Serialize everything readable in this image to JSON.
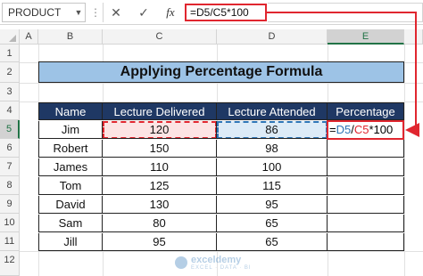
{
  "formula_bar": {
    "name_box": "PRODUCT",
    "dropdown_icon": "chevron-down-icon",
    "dots": "⋮",
    "cancel_glyph": "✕",
    "enter_glyph": "✓",
    "fx_label": "fx",
    "formula": "=D5/C5*100"
  },
  "columns": [
    "A",
    "B",
    "C",
    "D",
    "E"
  ],
  "selected_column": "E",
  "rows": [
    "1",
    "2",
    "3",
    "4",
    "5",
    "6",
    "7",
    "8",
    "9",
    "10",
    "11",
    "12"
  ],
  "selected_row": "5",
  "title": "Applying Percentage Formula",
  "table": {
    "headers": [
      "Name",
      "Lecture Delivered",
      "Lecture Attended",
      "Percentage"
    ],
    "rows": [
      [
        "Jim",
        "120",
        "86"
      ],
      [
        "Robert",
        "150",
        "98"
      ],
      [
        "James",
        "110",
        "100"
      ],
      [
        "Tom",
        "125",
        "115"
      ],
      [
        "David",
        "130",
        "95"
      ],
      [
        "Sam",
        "80",
        "65"
      ],
      [
        "Jill",
        "95",
        "65"
      ]
    ]
  },
  "active_cell": {
    "eq": "=",
    "ref1": "D5",
    "slash": "/",
    "ref2": "C5",
    "rest": "*100"
  },
  "watermark": {
    "name": "exceldemy",
    "tagline": "EXCEL · DATA · BI"
  },
  "colors": {
    "header_fill": "#1f3864",
    "title_fill": "#9dc3e6",
    "reference_red": "#e0262f",
    "reference_blue": "#2e75b6"
  }
}
